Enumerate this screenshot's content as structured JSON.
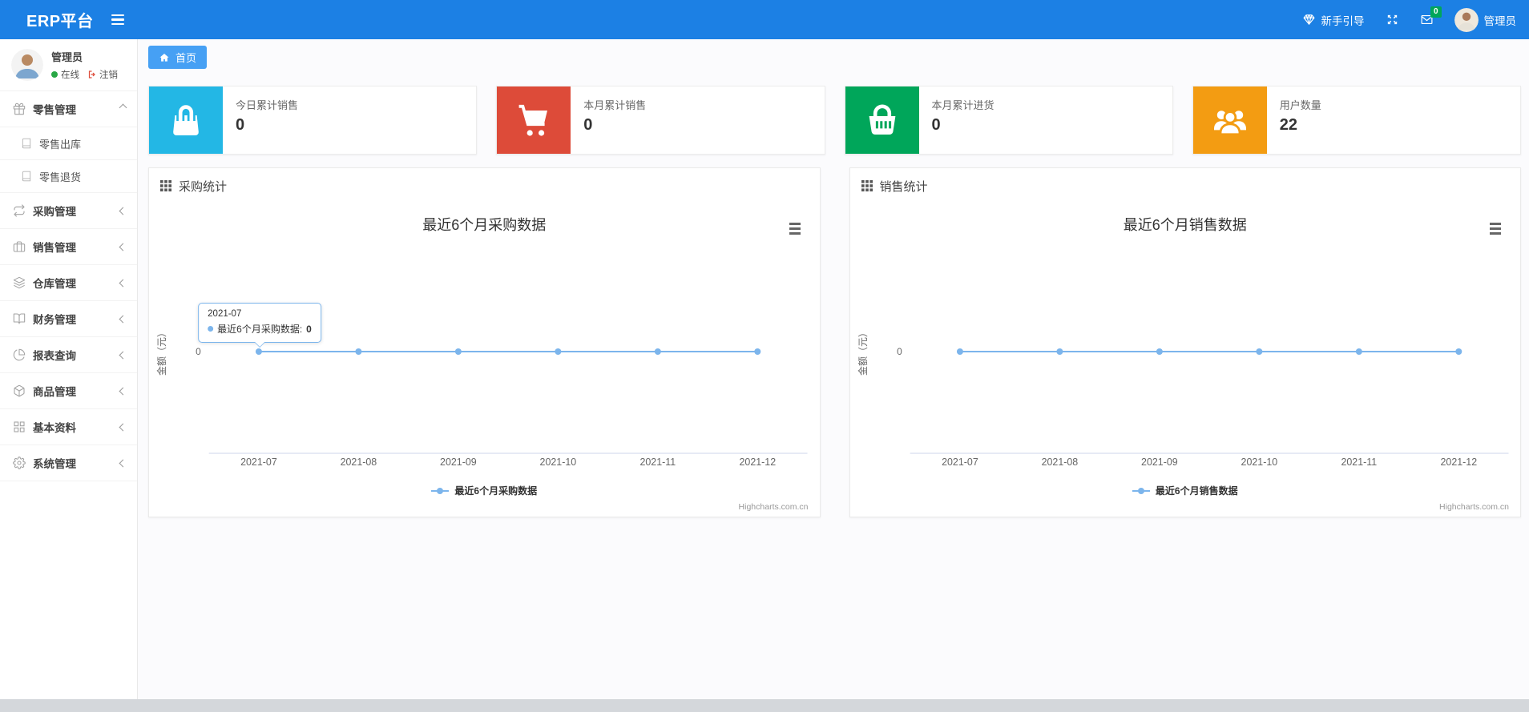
{
  "theme": {
    "navbar": "#1c80e4",
    "tab": "#46a0f4",
    "badge": "#00a65a",
    "series_blue": "#7cb5ec"
  },
  "app": {
    "brand": "ERP平台"
  },
  "navbar": {
    "guide_label": "新手引导",
    "messages_badge": "0",
    "user_name": "管理员"
  },
  "sidebar": {
    "profile": {
      "name": "管理员",
      "status": "在线",
      "logout": "注销"
    },
    "menu": [
      {
        "label": "零售管理",
        "expanded": true,
        "children": [
          "零售出库",
          "零售退货"
        ]
      },
      {
        "label": "采购管理"
      },
      {
        "label": "销售管理"
      },
      {
        "label": "仓库管理"
      },
      {
        "label": "财务管理"
      },
      {
        "label": "报表查询"
      },
      {
        "label": "商品管理"
      },
      {
        "label": "基本资料"
      },
      {
        "label": "系统管理"
      }
    ]
  },
  "tabs": {
    "home": "首页"
  },
  "stat_cards": [
    {
      "label": "今日累计销售",
      "value": "0",
      "color": "#23b7e5",
      "icon": "shopping-bag"
    },
    {
      "label": "本月累计销售",
      "value": "0",
      "color": "#dd4b39",
      "icon": "shopping-cart"
    },
    {
      "label": "本月累计进货",
      "value": "0",
      "color": "#00a65a",
      "icon": "shopping-basket"
    },
    {
      "label": "用户数量",
      "value": "22",
      "color": "#f39c12",
      "icon": "users"
    }
  ],
  "panels": [
    {
      "heading": "采购统计"
    },
    {
      "heading": "销售统计"
    }
  ],
  "chart_data": [
    {
      "type": "line",
      "title": "最近6个月采购数据",
      "categories": [
        "2021-07",
        "2021-08",
        "2021-09",
        "2021-10",
        "2021-11",
        "2021-12"
      ],
      "series": [
        {
          "name": "最近6个月采购数据",
          "values": [
            0,
            0,
            0,
            0,
            0,
            0
          ]
        }
      ],
      "xlabel": "",
      "ylabel": "金额（元）",
      "yticks": [
        "0"
      ],
      "ylim": [
        -1,
        1
      ],
      "grid": false,
      "legend_position": "bottom",
      "color": "#7cb5ec",
      "credits": "Highcharts.com.cn",
      "tooltip": {
        "point_index": 0,
        "header": "2021-07",
        "label": "最近6个月采购数据:",
        "value": "0"
      }
    },
    {
      "type": "line",
      "title": "最近6个月销售数据",
      "categories": [
        "2021-07",
        "2021-08",
        "2021-09",
        "2021-10",
        "2021-11",
        "2021-12"
      ],
      "series": [
        {
          "name": "最近6个月销售数据",
          "values": [
            0,
            0,
            0,
            0,
            0,
            0
          ]
        }
      ],
      "xlabel": "",
      "ylabel": "金额（元）",
      "yticks": [
        "0"
      ],
      "ylim": [
        -1,
        1
      ],
      "grid": false,
      "legend_position": "bottom",
      "color": "#7cb5ec",
      "credits": "Highcharts.com.cn"
    }
  ]
}
